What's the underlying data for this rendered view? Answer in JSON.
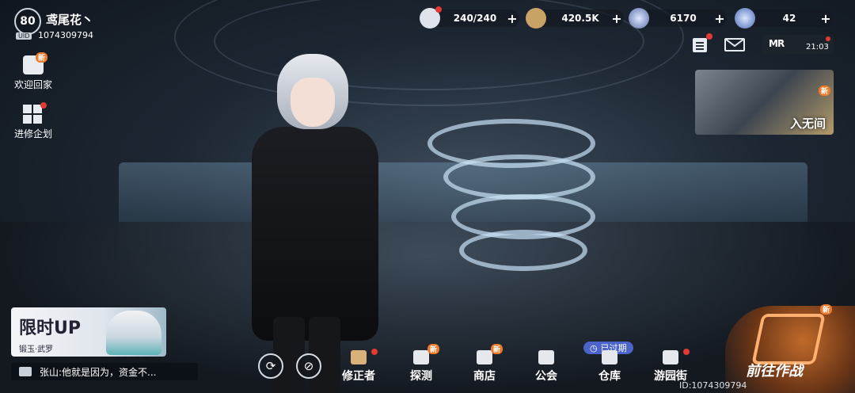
{
  "profile": {
    "level": "80",
    "name": "鸢尾花丶",
    "uid_tag": "UID",
    "uid": "1074309794"
  },
  "left_menu": [
    {
      "label": "欢迎回家",
      "badge": "新"
    },
    {
      "label": "进修企划"
    }
  ],
  "resources": [
    {
      "icon": "battery-icon",
      "value": "240/240"
    },
    {
      "icon": "coin-icon",
      "value": "420.5K"
    },
    {
      "icon": "crystal-star-icon",
      "value": "6170"
    },
    {
      "icon": "shard-icon",
      "value": "42"
    }
  ],
  "top_right": {
    "mr_logo": "MR",
    "time": "21:03"
  },
  "event_card": {
    "label": "入无间",
    "badge": "新"
  },
  "limited_up": {
    "title": "限时UP",
    "subtitle": "锻玉·武罗"
  },
  "chat": {
    "message": "张山:他就是因为，资金不..."
  },
  "bottom_nav": [
    {
      "label": "修正者",
      "badge": ""
    },
    {
      "label": "探测",
      "badge": "新"
    },
    {
      "label": "商店",
      "badge": "新"
    },
    {
      "label": "公会",
      "badge": ""
    },
    {
      "label": "仓库",
      "badge": ""
    },
    {
      "label": "游园街",
      "badge": ""
    }
  ],
  "expired_tag": "已过期",
  "battle": {
    "label": "前往作战",
    "badge": "新"
  },
  "footer_uid": "ID:1074309794",
  "colors": {
    "accent_orange": "#f07a2a",
    "alert_red": "#e53935",
    "expired_blue": "#4b64c9"
  }
}
